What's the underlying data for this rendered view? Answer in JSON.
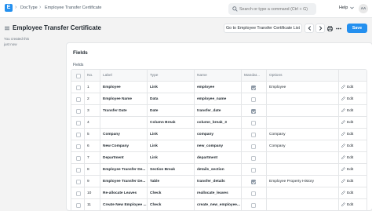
{
  "navbar": {
    "logo": "E",
    "breadcrumbs": [
      "DocType",
      "Employee Transfer Certificate"
    ],
    "search_placeholder": "Search or type a command (Ctrl + G)",
    "help_label": "Help",
    "avatar_initials": "AA"
  },
  "page": {
    "title": "Employee Transfer Certificate",
    "list_button": "Go to Employee Transfer Certificate List",
    "save_button": "Save"
  },
  "sidebar": {
    "meta_line1": "You created this",
    "meta_line2": "just now"
  },
  "section": {
    "title": "Fields",
    "grid_label": "Fields"
  },
  "grid": {
    "headers": {
      "no": "No.",
      "label": "Label",
      "type": "Type",
      "name": "Name",
      "mandatory": "Mandat...",
      "options": "Options"
    },
    "edit_label": "Edit",
    "rows": [
      {
        "no": "1",
        "label": "Employee",
        "type": "Link",
        "name": "employee",
        "mandatory": true,
        "options": "Employee"
      },
      {
        "no": "2",
        "label": "Employee Name",
        "type": "Data",
        "name": "employee_name",
        "mandatory": false,
        "options": ""
      },
      {
        "no": "3",
        "label": "Transfer Date",
        "type": "Date",
        "name": "transfer_date",
        "mandatory": true,
        "options": ""
      },
      {
        "no": "4",
        "label": "",
        "type": "Column Break",
        "name": "column_break_3",
        "mandatory": false,
        "options": ""
      },
      {
        "no": "5",
        "label": "Company",
        "type": "Link",
        "name": "company",
        "mandatory": false,
        "options": "Company"
      },
      {
        "no": "6",
        "label": "New Company",
        "type": "Link",
        "name": "new_company",
        "mandatory": false,
        "options": "Company"
      },
      {
        "no": "7",
        "label": "Department",
        "type": "Link",
        "name": "department",
        "mandatory": false,
        "options": ""
      },
      {
        "no": "8",
        "label": "Employee Transfer De...",
        "type": "Section Break",
        "name": "details_section",
        "mandatory": false,
        "options": ""
      },
      {
        "no": "9",
        "label": "Employee Transfer De...",
        "type": "Table",
        "name": "transfer_details",
        "mandatory": true,
        "options": "Employee Property History"
      },
      {
        "no": "10",
        "label": "Re-allocate Leaves",
        "type": "Check",
        "name": "reallocate_leaves",
        "mandatory": false,
        "options": ""
      },
      {
        "no": "11",
        "label": "Create New Employee ...",
        "type": "Check",
        "name": "create_new_employee...",
        "mandatory": false,
        "options": ""
      }
    ]
  }
}
